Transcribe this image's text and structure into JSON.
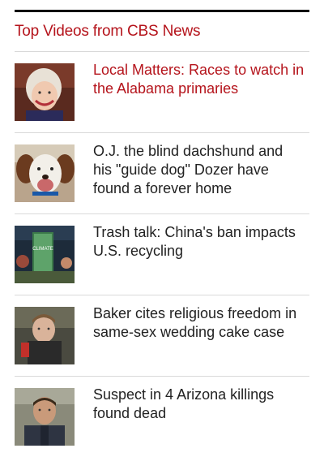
{
  "widget": {
    "title": "Top Videos from CBS News",
    "items": [
      {
        "headline": "Local Matters: Races to watch in the Alabama primaries",
        "thumb": "older-woman-portrait-thumbnail"
      },
      {
        "headline": "O.J. the blind dachshund and his \"guide dog\" Dozer have found a forever home",
        "thumb": "dog-thumbnail"
      },
      {
        "headline": "Trash talk: China's ban impacts U.S. recycling",
        "thumb": "climate-studio-thumbnail"
      },
      {
        "headline": "Baker cites religious freedom in same-sex wedding cake case",
        "thumb": "baker-thumbnail"
      },
      {
        "headline": "Suspect in 4 Arizona killings found dead",
        "thumb": "police-officer-thumbnail"
      }
    ],
    "colors": {
      "accent": "#b5141c",
      "text": "#222222",
      "divider": "#d9d9d9"
    }
  },
  "thumb_labels": {
    "climate_sign": "CLIMATE"
  }
}
